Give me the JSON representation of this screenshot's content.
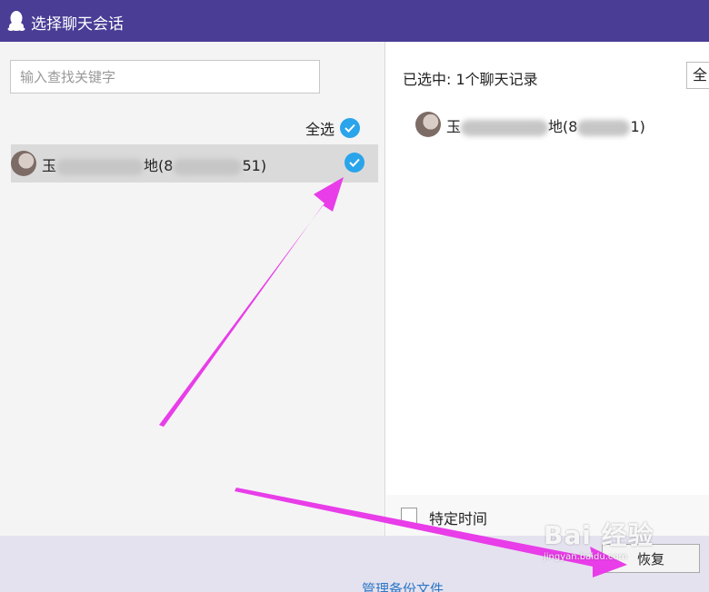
{
  "window": {
    "title": "选择聊天会话",
    "titlebar_color": "#4a3d96",
    "app_icon": "qq-penguin-icon"
  },
  "left_panel": {
    "search_placeholder": "输入查找关键字",
    "select_all_label": "全选",
    "select_all_checked": true,
    "contacts": [
      {
        "name_start": "玉",
        "name_mid": "地(8",
        "name_end": "51)",
        "checked": true,
        "partially_blurred": true
      }
    ]
  },
  "right_panel": {
    "summary": "已选中: 1个聊天记录",
    "select_all_button": "全",
    "selected": [
      {
        "name_start": "玉",
        "name_mid": "地(8",
        "name_end": "1)"
      }
    ],
    "specific_time_label": "特定时间",
    "specific_time_checked": false
  },
  "footer": {
    "restore_button": "恢复",
    "manage_backup_link": "管理备份文件"
  },
  "overlay": {
    "arrow_color": "#e83de8",
    "watermark_main": "Bai 经验",
    "watermark_sub": "jingyan.baidu.com"
  },
  "colors": {
    "accent_check": "#2aa4ea",
    "link": "#2b77c6"
  }
}
